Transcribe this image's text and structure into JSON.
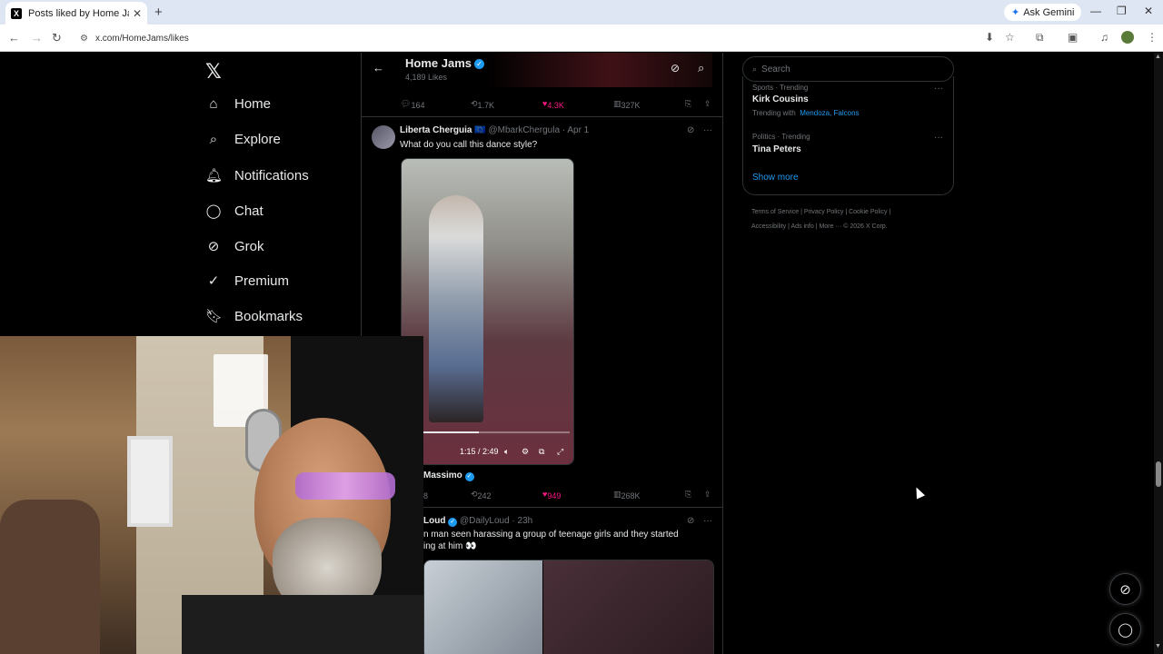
{
  "browser": {
    "tab_title": "Posts liked by Home Jams (@H",
    "tab_favicon": "X",
    "new_tab": "+",
    "ask_gemini": "Ask Gemini",
    "url": "x.com/HomeJams/likes"
  },
  "nav": {
    "items": [
      {
        "label": "Home",
        "icon": "home-icon"
      },
      {
        "label": "Explore",
        "icon": "search-icon"
      },
      {
        "label": "Notifications",
        "icon": "bell-icon"
      },
      {
        "label": "Chat",
        "icon": "chat-icon"
      },
      {
        "label": "Grok",
        "icon": "grok-icon"
      },
      {
        "label": "Premium",
        "icon": "premium-icon"
      },
      {
        "label": "Bookmarks",
        "icon": "bookmark-icon"
      }
    ]
  },
  "header": {
    "name": "Home Jams",
    "likes_count": "4,189 Likes"
  },
  "posts": [
    {
      "replies": "164",
      "reposts": "1.7K",
      "likes": "4.3K",
      "views": "327K"
    },
    {
      "author": "Liberta Cherguia",
      "flag": "🇪🇺",
      "handle": "@MbarkChergula",
      "date": "· Apr 1",
      "text": "What do you call this dance style?",
      "video_time": "1:15 / 2:49",
      "video_progress": 0.44,
      "credit": "Massimo",
      "replies": "8",
      "reposts": "242",
      "likes": "949",
      "views": "268K"
    },
    {
      "author": "Loud",
      "handle": "@DailyLoud",
      "date": "· 23h",
      "text_line1": "n man seen harassing a group of teenage girls and they started",
      "text_line2": "ing at him 👀"
    }
  ],
  "sidebar": {
    "search_placeholder": "Search",
    "trends": [
      {
        "category": "Sports · Trending",
        "name": "Kirk Cousins",
        "with_label": "Trending with",
        "with_links": "Mendoza, Falcons"
      },
      {
        "category": "Politics · Trending",
        "name": "Tina Peters"
      }
    ],
    "show_more": "Show more",
    "footer_line1": "Terms of Service  |  Privacy Policy  |  Cookie Policy  |",
    "footer_line2": "Accessibility  |  Ads info  |  More ···  © 2026 X Corp."
  }
}
